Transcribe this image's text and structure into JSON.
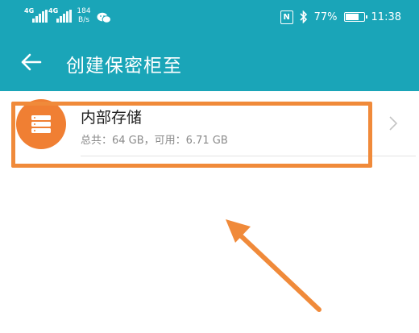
{
  "status_bar": {
    "sim1_label": "4G",
    "sim2_label": "4G",
    "net_speed_value": "184",
    "net_speed_unit": "B/s",
    "nfc_label": "N",
    "bluetooth_icon": "bluetooth-icon",
    "battery_level": 0.77,
    "battery_text": "77%",
    "time": "11:38"
  },
  "toolbar": {
    "title": "创建保密柜至"
  },
  "storage": {
    "title": "内部存储",
    "summary": "总共：64 GB，可用：6.71 GB",
    "icon": "storage-icon"
  },
  "colors": {
    "header": "#1aa5b8",
    "accent": "#f07f33",
    "annotation": "#f08a3a"
  }
}
